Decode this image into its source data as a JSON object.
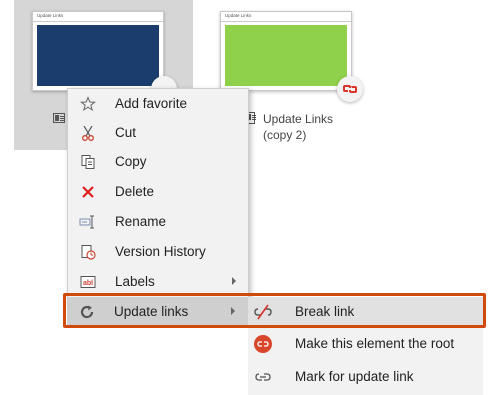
{
  "tiles": [
    {
      "thumb_title": "Update Links",
      "thumb_color": "#1a3d6d",
      "label_line1": "",
      "label_line2": ""
    },
    {
      "thumb_title": "Update Links",
      "thumb_color": "#8fd14a",
      "label_line1": "Update Links",
      "label_line2": "(copy 2)"
    }
  ],
  "context_menu": {
    "items": [
      {
        "label": "Add favorite",
        "icon": "star-icon"
      },
      {
        "label": "Cut",
        "icon": "scissors-icon"
      },
      {
        "label": "Copy",
        "icon": "copy-icon"
      },
      {
        "label": "Delete",
        "icon": "delete-x-icon"
      },
      {
        "label": "Rename",
        "icon": "rename-icon"
      },
      {
        "label": "Version History",
        "icon": "version-history-icon"
      },
      {
        "label": "Labels",
        "icon": "labels-icon",
        "has_submenu": true
      },
      {
        "label": "Update links",
        "icon": "refresh-icon",
        "has_submenu": true,
        "highlighted": true
      }
    ]
  },
  "submenu": {
    "items": [
      {
        "label": "Break link",
        "icon": "break-link-icon",
        "highlighted": true
      },
      {
        "label": "Make this element the root",
        "icon": "make-root-icon"
      },
      {
        "label": "Mark for update link",
        "icon": "mark-update-icon"
      }
    ]
  },
  "colors": {
    "highlight_outline": "#d24a0b",
    "link_badge_red": "#d9342b"
  }
}
